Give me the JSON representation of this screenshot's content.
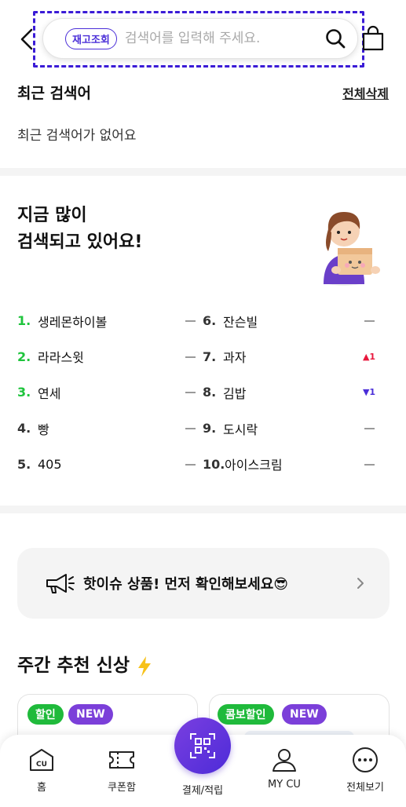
{
  "header": {
    "stock_badge": "재고조회",
    "search_placeholder": "검색어를 입력해 주세요."
  },
  "recent": {
    "title": "최근 검색어",
    "delete_all": "전체삭제",
    "empty_message": "최근 검색어가 없어요"
  },
  "popular": {
    "title_line1": "지금 많이",
    "title_line2": "검색되고 있어요!",
    "left": [
      {
        "rank": "1.",
        "label": "생레몬하이볼",
        "change": "none"
      },
      {
        "rank": "2.",
        "label": "라라스윗",
        "change": "none"
      },
      {
        "rank": "3.",
        "label": "연세",
        "change": "none"
      },
      {
        "rank": "4.",
        "label": "빵",
        "change": "none"
      },
      {
        "rank": "5.",
        "label": "405",
        "change": "none"
      }
    ],
    "right": [
      {
        "rank": "6.",
        "label": "잔슨빌",
        "change": "none"
      },
      {
        "rank": "7.",
        "label": "과자",
        "change": "up",
        "change_text": "▲1"
      },
      {
        "rank": "8.",
        "label": "김밥",
        "change": "down",
        "change_text": "▼1"
      },
      {
        "rank": "9.",
        "label": "도시락",
        "change": "none"
      },
      {
        "rank": "10.",
        "label": "아이스크림",
        "change": "none"
      }
    ]
  },
  "hot_issue": {
    "text": "핫이슈 상품! 먼저 확인해보세요😎"
  },
  "weekly": {
    "title": "주간 추천 신상",
    "cards": [
      {
        "tags": [
          "할인",
          "NEW"
        ]
      },
      {
        "tags": [
          "콤보할인",
          "NEW"
        ]
      }
    ]
  },
  "nav": {
    "home": "홈",
    "coupon": "쿠폰함",
    "pay": "결제/적립",
    "mycu": "MY CU",
    "all": "전체보기"
  },
  "colors": {
    "brand_purple": "#4a2ed8",
    "brand_green": "#1ec43c",
    "rank_up": "#e8173c",
    "rank_down": "#4a2ed8"
  }
}
